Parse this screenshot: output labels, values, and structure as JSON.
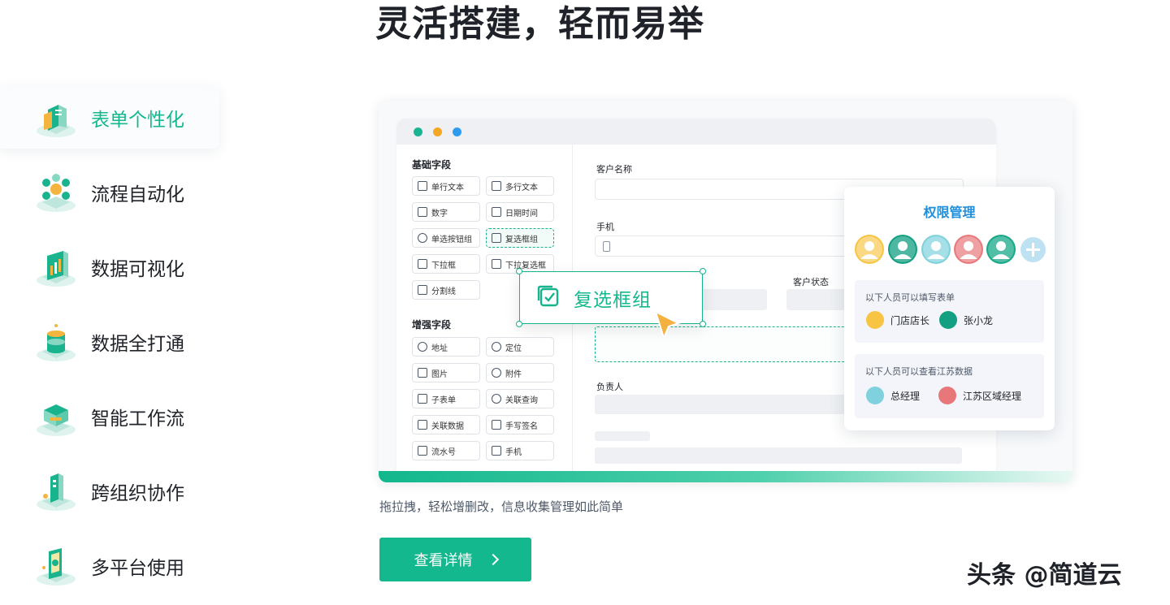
{
  "headline": "灵活搭建，轻而易举",
  "nav": {
    "items": [
      {
        "label": "表单个性化",
        "icon": "form-building-icon",
        "active": true
      },
      {
        "label": "流程自动化",
        "icon": "workflow-hub-icon",
        "active": false
      },
      {
        "label": "数据可视化",
        "icon": "data-dashboard-icon",
        "active": false
      },
      {
        "label": "数据全打通",
        "icon": "database-stack-icon",
        "active": false
      },
      {
        "label": "智能工作流",
        "icon": "smart-workflow-icon",
        "active": false
      },
      {
        "label": "跨组织协作",
        "icon": "collaboration-icon",
        "active": false
      },
      {
        "label": "多平台使用",
        "icon": "multi-platform-icon",
        "active": false
      }
    ]
  },
  "builder": {
    "basic_title": "基础字段",
    "basic_fields": [
      "单行文本",
      "多行文本",
      "数字",
      "日期时间",
      "单选按钮组",
      "复选框组",
      "下拉框",
      "下拉复选框",
      "分割线"
    ],
    "enhanced_title": "增强字段",
    "enhanced_fields": [
      "地址",
      "定位",
      "图片",
      "附件",
      "子表单",
      "关联查询",
      "关联数据",
      "手写签名",
      "流水号",
      "手机"
    ],
    "form": {
      "customer_name_label": "客户名称",
      "phone_label": "手机",
      "customer_status_label": "客户状态",
      "owner_label": "负责人"
    },
    "dragging_chip": "复选框组"
  },
  "permission": {
    "title": "权限管理",
    "fill_desc": "以下人员可以填写表单",
    "fill_people": [
      "门店店长",
      "张小龙"
    ],
    "view_desc": "以下人员可以查看江苏数据",
    "view_people": [
      "总经理",
      "江苏区域经理"
    ]
  },
  "caption": "拖拉拽，轻松增删改，信息收集管理如此简单",
  "cta_label": "查看详情",
  "watermark": "头条 @简道云",
  "colors": {
    "accent": "#14b88e",
    "title_blue": "#1f8fdc"
  }
}
